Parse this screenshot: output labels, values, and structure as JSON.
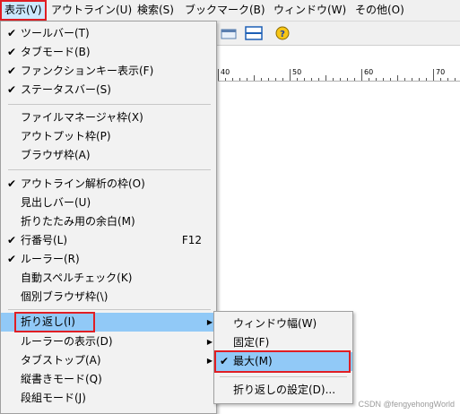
{
  "menubar": {
    "items": [
      {
        "label": "表示(V)"
      },
      {
        "label": "アウトライン(U)"
      },
      {
        "label": "検索(S)"
      },
      {
        "label": "ブックマーク(B)"
      },
      {
        "label": "ウィンドウ(W)"
      },
      {
        "label": "その他(O)"
      }
    ]
  },
  "ruler": {
    "labels": [
      "40",
      "50",
      "60",
      "70"
    ]
  },
  "menu": {
    "group1": [
      {
        "label": "ツールバー(T)",
        "checked": true
      },
      {
        "label": "タブモード(B)",
        "checked": true
      },
      {
        "label": "ファンクションキー表示(F)",
        "checked": true
      },
      {
        "label": "ステータスバー(S)",
        "checked": true
      }
    ],
    "group2": [
      {
        "label": "ファイルマネージャ枠(X)"
      },
      {
        "label": "アウトプット枠(P)"
      },
      {
        "label": "ブラウザ枠(A)"
      }
    ],
    "group3": [
      {
        "label": "アウトライン解析の枠(O)",
        "checked": true
      },
      {
        "label": "見出しバー(U)"
      },
      {
        "label": "折りたたみ用の余白(M)"
      },
      {
        "label": "行番号(L)",
        "checked": true,
        "shortcut": "F12"
      },
      {
        "label": "ルーラー(R)",
        "checked": true
      },
      {
        "label": "自動スペルチェック(K)"
      },
      {
        "label": "個別ブラウザ枠(\\)"
      }
    ],
    "group4": [
      {
        "label": "折り返し(I)",
        "submenu": true
      },
      {
        "label": "ルーラーの表示(D)",
        "submenu": true
      },
      {
        "label": "タブストップ(A)",
        "submenu": true
      },
      {
        "label": "縦書きモード(Q)"
      },
      {
        "label": "段組モード(J)"
      }
    ]
  },
  "submenu": {
    "items": [
      {
        "label": "ウィンドウ幅(W)"
      },
      {
        "label": "固定(F)"
      },
      {
        "label": "最大(M)",
        "checked": true
      }
    ],
    "settings": {
      "label": "折り返しの設定(D)..."
    }
  },
  "check_glyph": "✔",
  "arrow_glyph": "▶",
  "watermark": "CSDN @fengyehongWorld",
  "colors": {
    "highlight": "#91c9f7",
    "menubar_active": "#cce8ff",
    "annotation_red": "#e01e24"
  }
}
